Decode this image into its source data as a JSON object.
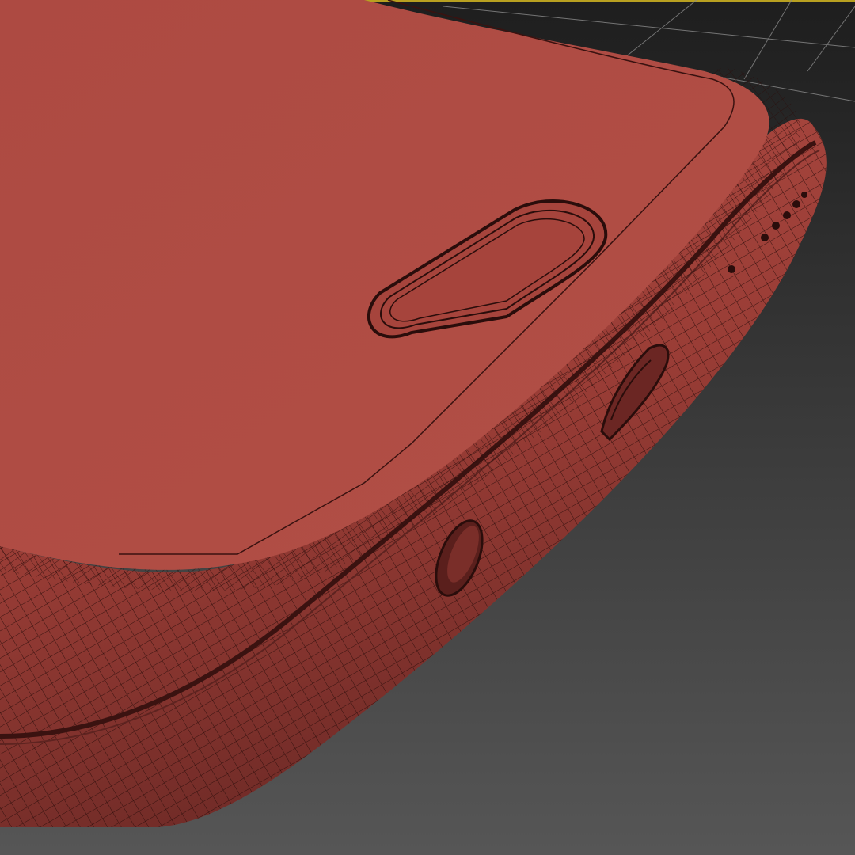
{
  "viewport": {
    "background_top": "#1e1e1e",
    "background_bottom": "#565656",
    "grid_color": "#8a8a8a",
    "selection_highlight_color": "#b8a020"
  },
  "model": {
    "object": "smartphone-bottom-edge",
    "display_mode": "wireframe-on-shaded",
    "face_color": "#ad4a42",
    "face_shadow_color": "#6e2a26",
    "wire_color": "#2a0d0b",
    "features": [
      "home-button",
      "audio-jack",
      "charging-port",
      "microphone-hole",
      "speaker-grille"
    ]
  }
}
